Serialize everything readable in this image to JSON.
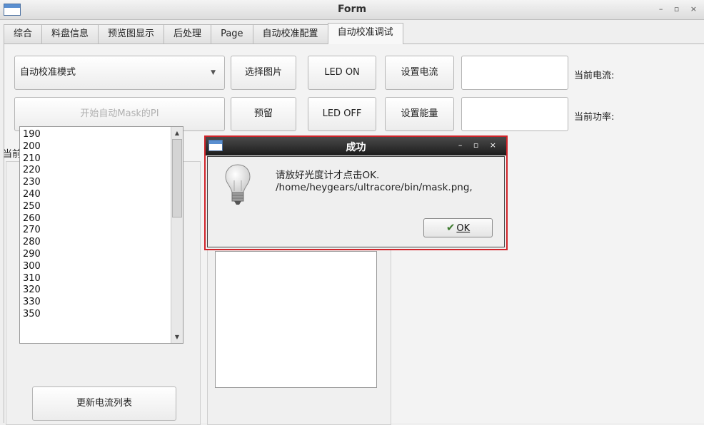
{
  "window": {
    "title": "Form",
    "controls": "– ▫ ×"
  },
  "tabs": [
    {
      "label": "综合"
    },
    {
      "label": "料盘信息"
    },
    {
      "label": "预览图显示"
    },
    {
      "label": "后处理"
    },
    {
      "label": "Page"
    },
    {
      "label": "自动校准配置"
    },
    {
      "label": "自动校准调试"
    }
  ],
  "toolbar": {
    "mode_select": "自动校准模式",
    "select_image": "选择图片",
    "led_on": "LED ON",
    "set_current": "设置电流",
    "current_value": "",
    "current_label": "当前电流:",
    "start_mask": "开始自动Mask的PI",
    "reserve": "预留",
    "led_off": "LED OFF",
    "set_energy": "设置能量",
    "energy_value": "",
    "power_label": "当前功率:"
  },
  "current_list": {
    "title": "当前电流列表",
    "items": [
      "190",
      "200",
      "210",
      "220",
      "230",
      "240",
      "250",
      "260",
      "270",
      "280",
      "290",
      "300",
      "310",
      "320",
      "330",
      "350"
    ],
    "update_button": "更新电流列表"
  },
  "dialog": {
    "title": "成功",
    "controls": "– ▫ ×",
    "message_line1": "请放好光度计才点击OK.",
    "message_line2": "/home/heygears/ultracore/bin/mask.png,",
    "ok_button": "OK"
  }
}
